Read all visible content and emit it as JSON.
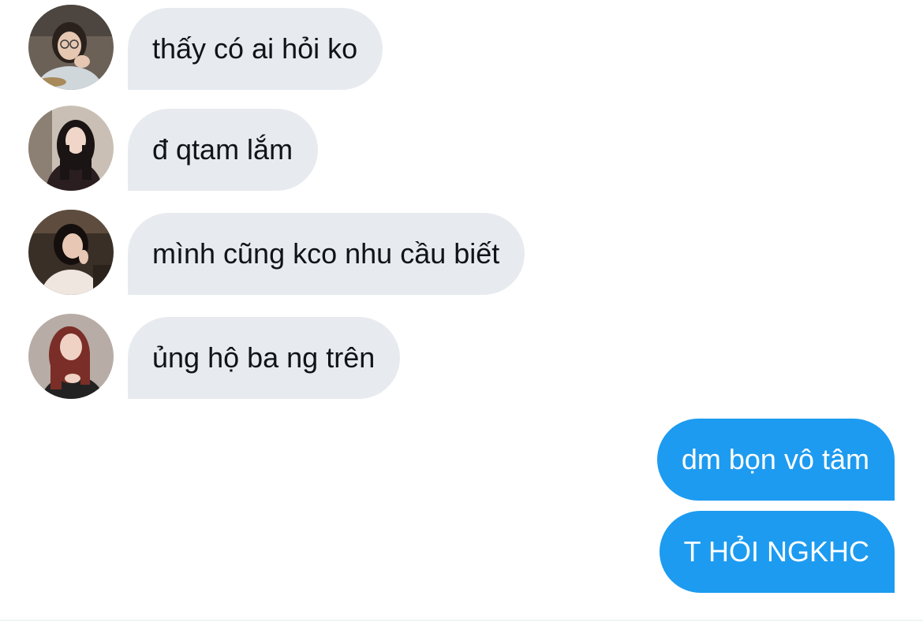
{
  "incoming": [
    {
      "text": "thấy có ai hỏi ko",
      "avatar": {
        "bg": "#6b6157",
        "skin": "#e6c7b2",
        "hair": "#2a211c",
        "top": "#cfd7db"
      }
    },
    {
      "text": "đ qtam lắm",
      "avatar": {
        "bg": "#c9bfb4",
        "skin": "#f0d6c8",
        "hair": "#1a1414",
        "top": "#2a1e20"
      }
    },
    {
      "text": "mình cũng kco nhu cầu biết",
      "avatar": {
        "bg": "#3a2f27",
        "skin": "#e8c8b4",
        "hair": "#140f0d",
        "top": "#efe6df"
      }
    },
    {
      "text": "ủng hộ ba ng trên",
      "avatar": {
        "bg": "#b8aca6",
        "skin": "#f0d2c4",
        "hair": "#7a2e27",
        "top": "#222222"
      }
    }
  ],
  "outgoing": [
    {
      "text": "dm bọn vô tâm"
    },
    {
      "text": "T HỎI NGKHC"
    }
  ],
  "colors": {
    "incoming_bubble": "#e7ebef",
    "outgoing_bubble": "#1d9bf0",
    "incoming_text": "#0f1419",
    "outgoing_text": "#ffffff"
  }
}
